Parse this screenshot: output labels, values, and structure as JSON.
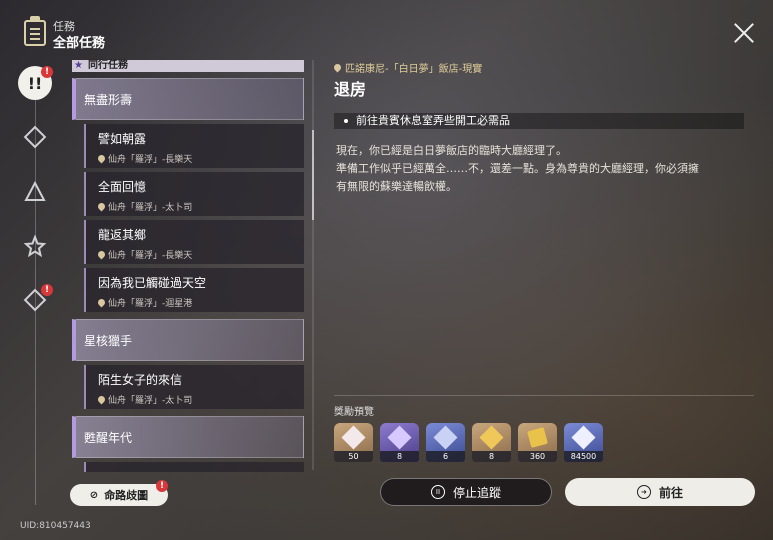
{
  "header": {
    "title": "任務",
    "subtitle": "全部任務"
  },
  "rail": {
    "active_badge": "!",
    "badge_symbol": "!"
  },
  "list": {
    "category_label": "同行任務",
    "groups": [
      {
        "label": "無盡形壽"
      },
      {
        "label": "星核獵手"
      },
      {
        "label": "甦醒年代"
      }
    ],
    "items": [
      {
        "title": "譬如朝露",
        "location": "仙舟「羅浮」-長樂天"
      },
      {
        "title": "全面回憶",
        "location": "仙舟「羅浮」-太卜司"
      },
      {
        "title": "龍返其鄉",
        "location": "仙舟「羅浮」-長樂天"
      },
      {
        "title": "因為我已觸碰過天空",
        "location": "仙舟「羅浮」-迴星港"
      },
      {
        "title": "陌生女子的來信",
        "location": "仙舟「羅浮」-太卜司"
      }
    ]
  },
  "detail": {
    "location": "匹諾康尼-「白日夢」飯店-現實",
    "title": "退房",
    "objective": "前往貴賓休息室弄些開工必需品",
    "description_lines": [
      "現在，你已經是白日夢飯店的臨時大廳經理了。",
      "準備工作似乎已經萬全……不，還差一點。身為尊貴的大廳經理，你必須擁",
      "有無限的蘇樂達暢飲權。"
    ],
    "reward_label": "獎勵預覽",
    "rewards": [
      {
        "icon": "crystal-icon",
        "count": "50",
        "style": "gold"
      },
      {
        "icon": "purple-book-icon",
        "count": "8",
        "style": "purple"
      },
      {
        "icon": "weapon-material-icon",
        "count": "6",
        "style": "blue"
      },
      {
        "icon": "credit-icon",
        "count": "8",
        "style": "gold"
      },
      {
        "icon": "ticket-icon",
        "count": "360",
        "style": "gold"
      },
      {
        "icon": "exp-book-icon",
        "count": "84500",
        "style": "blue"
      }
    ]
  },
  "buttons": {
    "path_label": "命路歧圖",
    "stop_label": "停止追蹤",
    "go_label": "前往"
  },
  "footer": {
    "uid": "UID:810457443"
  },
  "colors": {
    "accent": "#b49be0",
    "badge": "#d8383a",
    "location": "#e1cf9a"
  }
}
